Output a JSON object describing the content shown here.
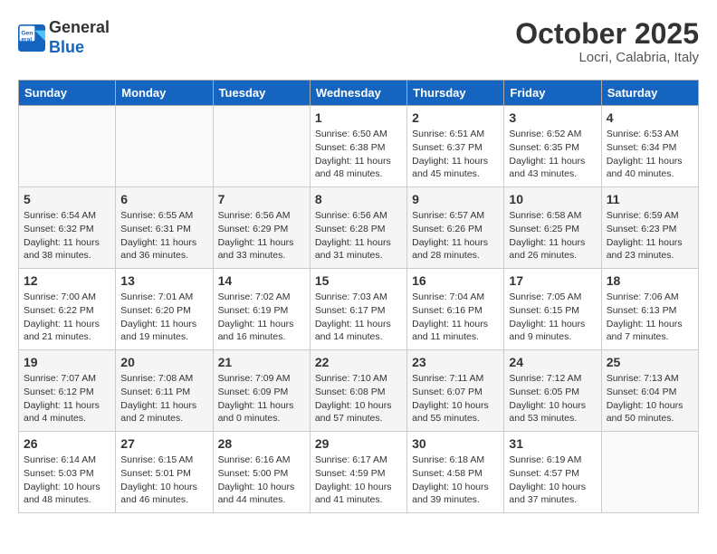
{
  "header": {
    "logo_line1": "General",
    "logo_line2": "Blue",
    "month": "October 2025",
    "location": "Locri, Calabria, Italy"
  },
  "weekdays": [
    "Sunday",
    "Monday",
    "Tuesday",
    "Wednesday",
    "Thursday",
    "Friday",
    "Saturday"
  ],
  "weeks": [
    [
      {
        "day": "",
        "info": ""
      },
      {
        "day": "",
        "info": ""
      },
      {
        "day": "",
        "info": ""
      },
      {
        "day": "1",
        "info": "Sunrise: 6:50 AM\nSunset: 6:38 PM\nDaylight: 11 hours\nand 48 minutes."
      },
      {
        "day": "2",
        "info": "Sunrise: 6:51 AM\nSunset: 6:37 PM\nDaylight: 11 hours\nand 45 minutes."
      },
      {
        "day": "3",
        "info": "Sunrise: 6:52 AM\nSunset: 6:35 PM\nDaylight: 11 hours\nand 43 minutes."
      },
      {
        "day": "4",
        "info": "Sunrise: 6:53 AM\nSunset: 6:34 PM\nDaylight: 11 hours\nand 40 minutes."
      }
    ],
    [
      {
        "day": "5",
        "info": "Sunrise: 6:54 AM\nSunset: 6:32 PM\nDaylight: 11 hours\nand 38 minutes."
      },
      {
        "day": "6",
        "info": "Sunrise: 6:55 AM\nSunset: 6:31 PM\nDaylight: 11 hours\nand 36 minutes."
      },
      {
        "day": "7",
        "info": "Sunrise: 6:56 AM\nSunset: 6:29 PM\nDaylight: 11 hours\nand 33 minutes."
      },
      {
        "day": "8",
        "info": "Sunrise: 6:56 AM\nSunset: 6:28 PM\nDaylight: 11 hours\nand 31 minutes."
      },
      {
        "day": "9",
        "info": "Sunrise: 6:57 AM\nSunset: 6:26 PM\nDaylight: 11 hours\nand 28 minutes."
      },
      {
        "day": "10",
        "info": "Sunrise: 6:58 AM\nSunset: 6:25 PM\nDaylight: 11 hours\nand 26 minutes."
      },
      {
        "day": "11",
        "info": "Sunrise: 6:59 AM\nSunset: 6:23 PM\nDaylight: 11 hours\nand 23 minutes."
      }
    ],
    [
      {
        "day": "12",
        "info": "Sunrise: 7:00 AM\nSunset: 6:22 PM\nDaylight: 11 hours\nand 21 minutes."
      },
      {
        "day": "13",
        "info": "Sunrise: 7:01 AM\nSunset: 6:20 PM\nDaylight: 11 hours\nand 19 minutes."
      },
      {
        "day": "14",
        "info": "Sunrise: 7:02 AM\nSunset: 6:19 PM\nDaylight: 11 hours\nand 16 minutes."
      },
      {
        "day": "15",
        "info": "Sunrise: 7:03 AM\nSunset: 6:17 PM\nDaylight: 11 hours\nand 14 minutes."
      },
      {
        "day": "16",
        "info": "Sunrise: 7:04 AM\nSunset: 6:16 PM\nDaylight: 11 hours\nand 11 minutes."
      },
      {
        "day": "17",
        "info": "Sunrise: 7:05 AM\nSunset: 6:15 PM\nDaylight: 11 hours\nand 9 minutes."
      },
      {
        "day": "18",
        "info": "Sunrise: 7:06 AM\nSunset: 6:13 PM\nDaylight: 11 hours\nand 7 minutes."
      }
    ],
    [
      {
        "day": "19",
        "info": "Sunrise: 7:07 AM\nSunset: 6:12 PM\nDaylight: 11 hours\nand 4 minutes."
      },
      {
        "day": "20",
        "info": "Sunrise: 7:08 AM\nSunset: 6:11 PM\nDaylight: 11 hours\nand 2 minutes."
      },
      {
        "day": "21",
        "info": "Sunrise: 7:09 AM\nSunset: 6:09 PM\nDaylight: 11 hours\nand 0 minutes."
      },
      {
        "day": "22",
        "info": "Sunrise: 7:10 AM\nSunset: 6:08 PM\nDaylight: 10 hours\nand 57 minutes."
      },
      {
        "day": "23",
        "info": "Sunrise: 7:11 AM\nSunset: 6:07 PM\nDaylight: 10 hours\nand 55 minutes."
      },
      {
        "day": "24",
        "info": "Sunrise: 7:12 AM\nSunset: 6:05 PM\nDaylight: 10 hours\nand 53 minutes."
      },
      {
        "day": "25",
        "info": "Sunrise: 7:13 AM\nSunset: 6:04 PM\nDaylight: 10 hours\nand 50 minutes."
      }
    ],
    [
      {
        "day": "26",
        "info": "Sunrise: 6:14 AM\nSunset: 5:03 PM\nDaylight: 10 hours\nand 48 minutes."
      },
      {
        "day": "27",
        "info": "Sunrise: 6:15 AM\nSunset: 5:01 PM\nDaylight: 10 hours\nand 46 minutes."
      },
      {
        "day": "28",
        "info": "Sunrise: 6:16 AM\nSunset: 5:00 PM\nDaylight: 10 hours\nand 44 minutes."
      },
      {
        "day": "29",
        "info": "Sunrise: 6:17 AM\nSunset: 4:59 PM\nDaylight: 10 hours\nand 41 minutes."
      },
      {
        "day": "30",
        "info": "Sunrise: 6:18 AM\nSunset: 4:58 PM\nDaylight: 10 hours\nand 39 minutes."
      },
      {
        "day": "31",
        "info": "Sunrise: 6:19 AM\nSunset: 4:57 PM\nDaylight: 10 hours\nand 37 minutes."
      },
      {
        "day": "",
        "info": ""
      }
    ]
  ]
}
